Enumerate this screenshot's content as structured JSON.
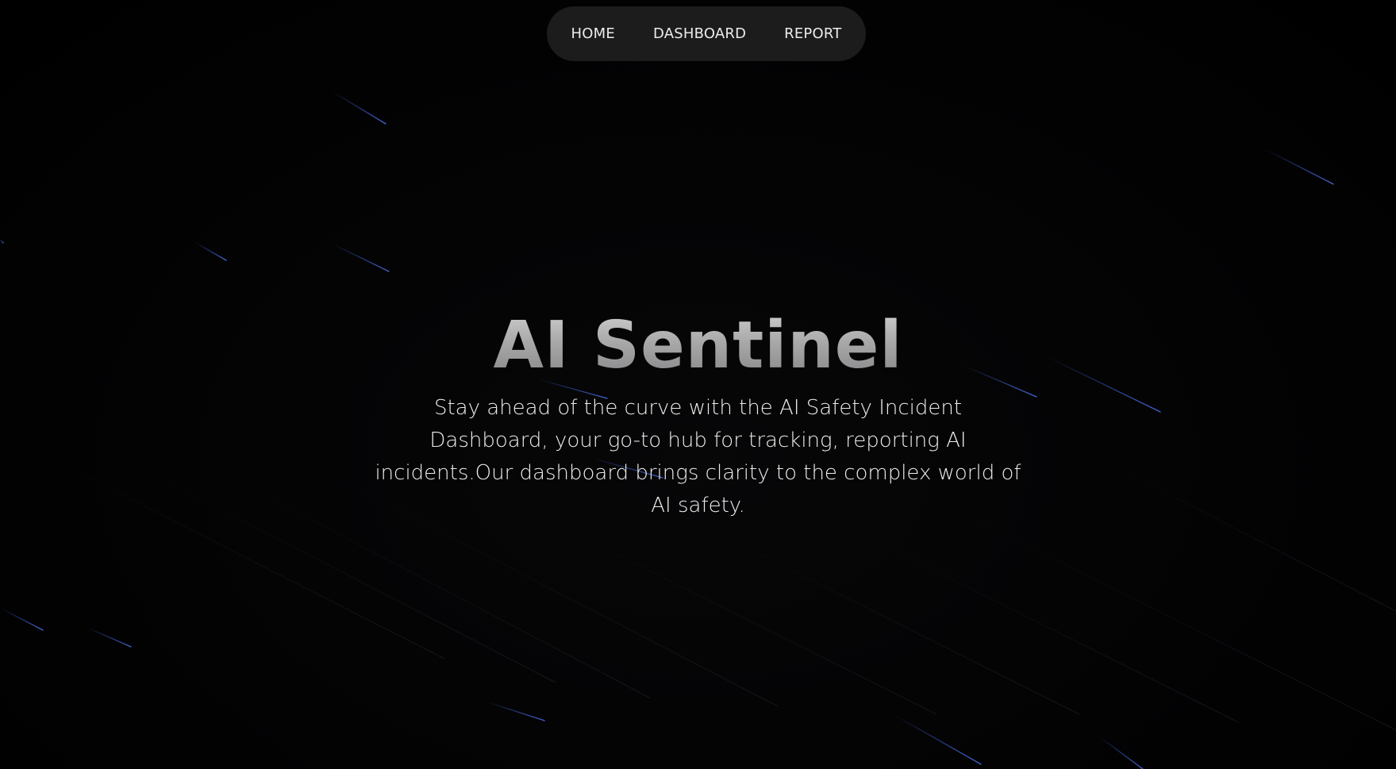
{
  "nav": {
    "items": [
      {
        "label": "HOME"
      },
      {
        "label": "DASHBOARD"
      },
      {
        "label": "REPORT"
      }
    ]
  },
  "hero": {
    "title": "AI Sentinel",
    "description": "Stay ahead of the curve with the AI Safety Incident Dashboard, your go-to hub for tracking, reporting AI incidents.Our dashboard brings clarity to the complex world of AI safety."
  },
  "colors": {
    "background": "#020203",
    "nav_background": "#1c1c1c",
    "streak": "#3a5bd0"
  }
}
